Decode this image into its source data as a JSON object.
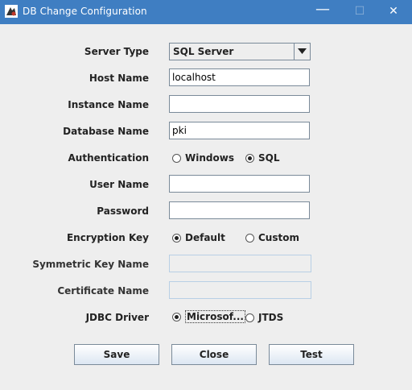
{
  "window": {
    "title": "DB Change Configuration",
    "minimize_glyph": "—",
    "maximize_glyph": "☐",
    "close_glyph": "✕",
    "title_bar_color": "#3f7ec2"
  },
  "form": {
    "server_type": {
      "label": "Server Type",
      "value": "SQL Server"
    },
    "host_name": {
      "label": "Host Name",
      "value": "localhost"
    },
    "instance_name": {
      "label": "Instance Name",
      "value": ""
    },
    "database_name": {
      "label": "Database Name",
      "value": "pki"
    },
    "authentication": {
      "label": "Authentication",
      "options": [
        "Windows",
        "SQL"
      ],
      "selected": "SQL"
    },
    "user_name": {
      "label": "User Name",
      "value": ""
    },
    "password": {
      "label": "Password",
      "value": ""
    },
    "encryption_key": {
      "label": "Encryption Key",
      "options": [
        "Default",
        "Custom"
      ],
      "selected": "Default"
    },
    "symmetric_key_name": {
      "label": "Symmetric Key Name",
      "value": "",
      "disabled": true
    },
    "certificate_name": {
      "label": "Certificate Name",
      "value": "",
      "disabled": true
    },
    "jdbc_driver": {
      "label": "JDBC Driver",
      "options": [
        "Microsof...",
        "JTDS"
      ],
      "selected": "Microsof..."
    }
  },
  "buttons": {
    "save": "Save",
    "close": "Close",
    "test": "Test"
  }
}
